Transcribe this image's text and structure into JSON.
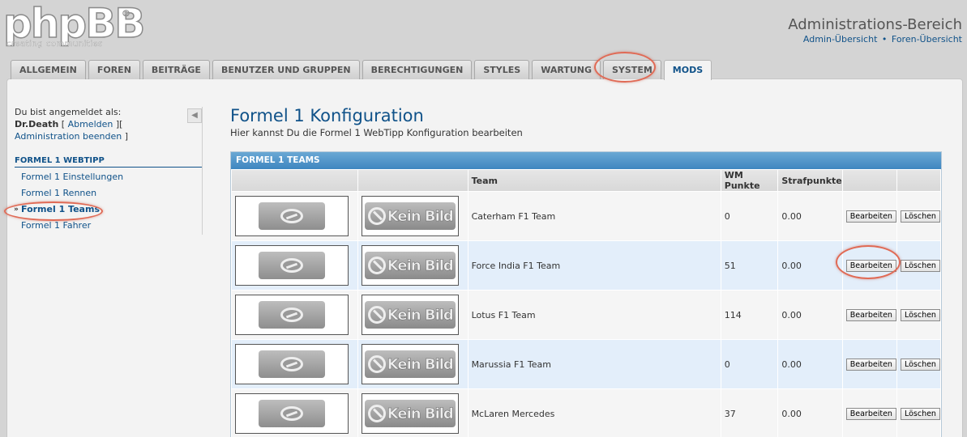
{
  "header": {
    "logo_text": "phpBB",
    "logo_reg": "®",
    "logo_sub": "creating communities",
    "title": "Administrations-Bereich",
    "links": [
      "Admin-Übersicht",
      "Foren-Übersicht"
    ],
    "link_separator": "•"
  },
  "tabs": [
    {
      "label": "ALLGEMEIN",
      "active": false
    },
    {
      "label": "FOREN",
      "active": false
    },
    {
      "label": "BEITRÄGE",
      "active": false
    },
    {
      "label": "BENUTZER UND GRUPPEN",
      "active": false
    },
    {
      "label": "BERECHTIGUNGEN",
      "active": false
    },
    {
      "label": "STYLES",
      "active": false
    },
    {
      "label": "WARTUNG",
      "active": false
    },
    {
      "label": "SYSTEM",
      "active": false
    },
    {
      "label": "MODS",
      "active": true
    }
  ],
  "sidebar": {
    "login_label": "Du bist angemeldet als:",
    "username": "Dr.Death",
    "logout_label": "Abmelden",
    "admin_end_label": "Administration beenden",
    "collapse_icon": "◀",
    "section_title": "FORMEL 1 WEBTIPP",
    "items": [
      {
        "label": "Formel 1 Einstellungen",
        "active": false
      },
      {
        "label": "Formel 1 Rennen",
        "active": false
      },
      {
        "label": "Formel 1 Teams",
        "active": true
      },
      {
        "label": "Formel 1 Fahrer",
        "active": false
      }
    ]
  },
  "main": {
    "title": "Formel 1 Konfiguration",
    "description": "Hier kannst Du die Formel 1 WebTipp Konfiguration bearbeiten",
    "table_caption": "FORMEL 1 TEAMS",
    "columns": [
      "",
      "",
      "Team",
      "WM Punkte",
      "Strafpunkte",
      "",
      ""
    ],
    "kein_bild": "Kein Bild",
    "edit_label": "Bearbeiten",
    "delete_label": "Löschen",
    "rows": [
      {
        "team": "Caterham F1 Team",
        "points": "0",
        "penalty": "0.00"
      },
      {
        "team": "Force India F1 Team",
        "points": "51",
        "penalty": "0.00"
      },
      {
        "team": "Lotus F1 Team",
        "points": "114",
        "penalty": "0.00"
      },
      {
        "team": "Marussia F1 Team",
        "points": "0",
        "penalty": "0.00"
      },
      {
        "team": "McLaren Mercedes",
        "points": "37",
        "penalty": "0.00"
      }
    ]
  },
  "colors": {
    "link": "#105289",
    "highlight": "#e06a55",
    "caption": "#3e86c0"
  }
}
